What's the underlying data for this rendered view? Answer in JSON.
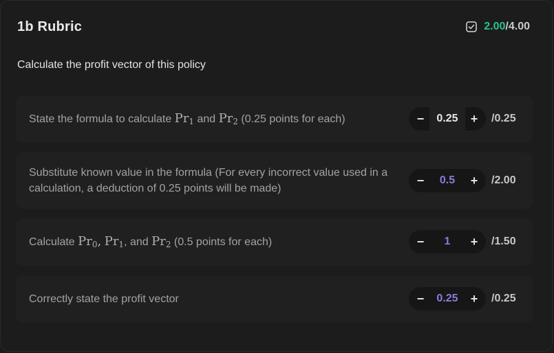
{
  "header": {
    "title": "1b Rubric",
    "score_got": "2.00",
    "score_total": "/4.00",
    "icon": "checkbox-checked-icon"
  },
  "question": "Calculate the profit vector of this policy",
  "colors": {
    "score_green": "#2bc18e",
    "value_purple": "#8d7bd9"
  },
  "items": [
    {
      "pre": "State the formula to calculate ",
      "m1": "Pr",
      "s1": "1",
      "mid1": " and ",
      "m2": "Pr",
      "s2": "2",
      "post": " (0.25 points for each)",
      "value": "0.25",
      "max": "/0.25",
      "minus": "−",
      "plus": "+"
    },
    {
      "text": "Substitute known value in the formula (For every incorrect value used in a calculation, a deduction of 0.25 points will be made)",
      "value": "0.5",
      "max": "/2.00",
      "minus": "−",
      "plus": "+"
    },
    {
      "pre": "Calculate ",
      "m0": "Pr",
      "s0": "0",
      "c0": ",",
      "m1": "Pr",
      "s1": "1",
      "c1": ", and ",
      "m2": "Pr",
      "s2": "2",
      "post": " (0.5 points for each)",
      "value": "1",
      "max": "/1.50",
      "minus": "−",
      "plus": "+"
    },
    {
      "text": "Correctly state the profit vector",
      "value": "0.25",
      "max": "/0.25",
      "minus": "−",
      "plus": "+"
    }
  ]
}
